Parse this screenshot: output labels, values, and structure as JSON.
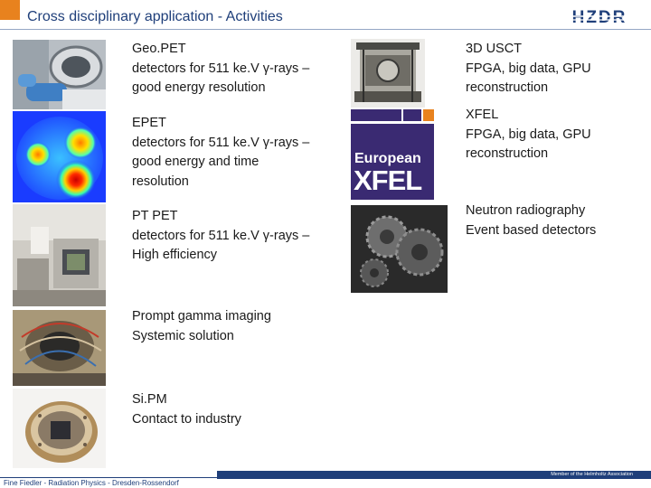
{
  "header": {
    "title": "Cross disciplinary application - Activities",
    "logo_text": "HZDR",
    "accent_color": "#e8821e",
    "brand_color": "#1f3f7a"
  },
  "items": [
    {
      "title": "Geo.PET",
      "lines": [
        "detectors for 511 ke.V γ-rays –",
        "good energy resolution"
      ]
    },
    {
      "title": "EPET",
      "lines": [
        "detectors for 511 ke.V γ-rays –",
        "good energy and time",
        "resolution"
      ]
    },
    {
      "title": "PT PET",
      "lines": [
        "detectors for 511 ke.V γ-rays –",
        "High efficiency"
      ]
    },
    {
      "title": "Prompt gamma imaging",
      "lines": [
        "Systemic solution"
      ]
    },
    {
      "title": "Si.PM",
      "lines": [
        "Contact to industry"
      ]
    },
    {
      "title": "3D USCT",
      "lines": [
        "FPGA, big data, GPU",
        "reconstruction"
      ]
    },
    {
      "title": "XFEL",
      "lines": [
        "FPGA, big data, GPU",
        "reconstruction"
      ]
    },
    {
      "title": "Neutron radiography",
      "lines": [
        "Event based detectors"
      ]
    }
  ],
  "xfel_logo": {
    "line1": "European",
    "line2": "XFEL"
  },
  "footer": {
    "text": "Fine Fiedler - Radiation Physics - Dresden-Rossendorf",
    "member": "Member of the Helmholtz Association"
  }
}
